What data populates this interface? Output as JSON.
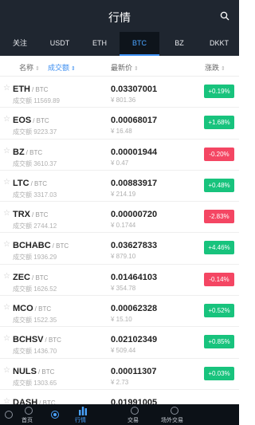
{
  "header": {
    "title": "行情"
  },
  "tabs": [
    {
      "label": "关注",
      "active": false
    },
    {
      "label": "USDT",
      "active": false
    },
    {
      "label": "ETH",
      "active": false
    },
    {
      "label": "BTC",
      "active": true
    },
    {
      "label": "BZ",
      "active": false
    },
    {
      "label": "DKKT",
      "active": false
    }
  ],
  "columns": {
    "name": "名称",
    "volume": "成交额",
    "price": "最新价",
    "change": "涨跌"
  },
  "volume_prefix": "成交额",
  "rows": [
    {
      "base": "ETH",
      "quote": "/ BTC",
      "volume": "11569.89",
      "price": "0.03307001",
      "cny": "¥ 801.36",
      "change": "+0.19%",
      "up": true
    },
    {
      "base": "EOS",
      "quote": "/ BTC",
      "volume": "9223.37",
      "price": "0.00068017",
      "cny": "¥ 16.48",
      "change": "+1.68%",
      "up": true
    },
    {
      "base": "BZ",
      "quote": "/ BTC",
      "volume": "3610.37",
      "price": "0.00001944",
      "cny": "¥ 0.47",
      "change": "-0.20%",
      "up": false
    },
    {
      "base": "LTC",
      "quote": "/ BTC",
      "volume": "3317.03",
      "price": "0.00883917",
      "cny": "¥ 214.19",
      "change": "+0.48%",
      "up": true
    },
    {
      "base": "TRX",
      "quote": "/ BTC",
      "volume": "2744.12",
      "price": "0.00000720",
      "cny": "¥ 0.1744",
      "change": "-2.83%",
      "up": false
    },
    {
      "base": "BCHABC",
      "quote": "/ BTC",
      "volume": "1936.29",
      "price": "0.03627833",
      "cny": "¥ 879.10",
      "change": "+4.46%",
      "up": true
    },
    {
      "base": "ZEC",
      "quote": "/ BTC",
      "volume": "1626.52",
      "price": "0.01464103",
      "cny": "¥ 354.78",
      "change": "-0.14%",
      "up": false
    },
    {
      "base": "MCO",
      "quote": "/ BTC",
      "volume": "1522.35",
      "price": "0.00062328",
      "cny": "¥ 15.10",
      "change": "+0.52%",
      "up": true
    },
    {
      "base": "BCHSV",
      "quote": "/ BTC",
      "volume": "1436.70",
      "price": "0.02102349",
      "cny": "¥ 509.44",
      "change": "+0.85%",
      "up": true
    },
    {
      "base": "NULS",
      "quote": "/ BTC",
      "volume": "1303.65",
      "price": "0.00011307",
      "cny": "¥ 2.73",
      "change": "+0.03%",
      "up": true
    },
    {
      "base": "DASH",
      "quote": "/ BTC",
      "volume": "",
      "price": "0.01991005",
      "cny": "",
      "change": "",
      "up": true
    }
  ],
  "bottom_nav": [
    {
      "label": "首页",
      "icon": "home-icon",
      "active": false
    },
    {
      "label": "行情",
      "icon": "chart-icon",
      "active": true
    },
    {
      "label": "交易",
      "icon": "trade-icon",
      "active": false
    },
    {
      "label": "场外交易",
      "icon": "otc-icon",
      "active": false
    }
  ],
  "colors": {
    "header_bg": "#1f2630",
    "accent": "#3b8df0",
    "up": "#18c37d",
    "down": "#f44663"
  }
}
